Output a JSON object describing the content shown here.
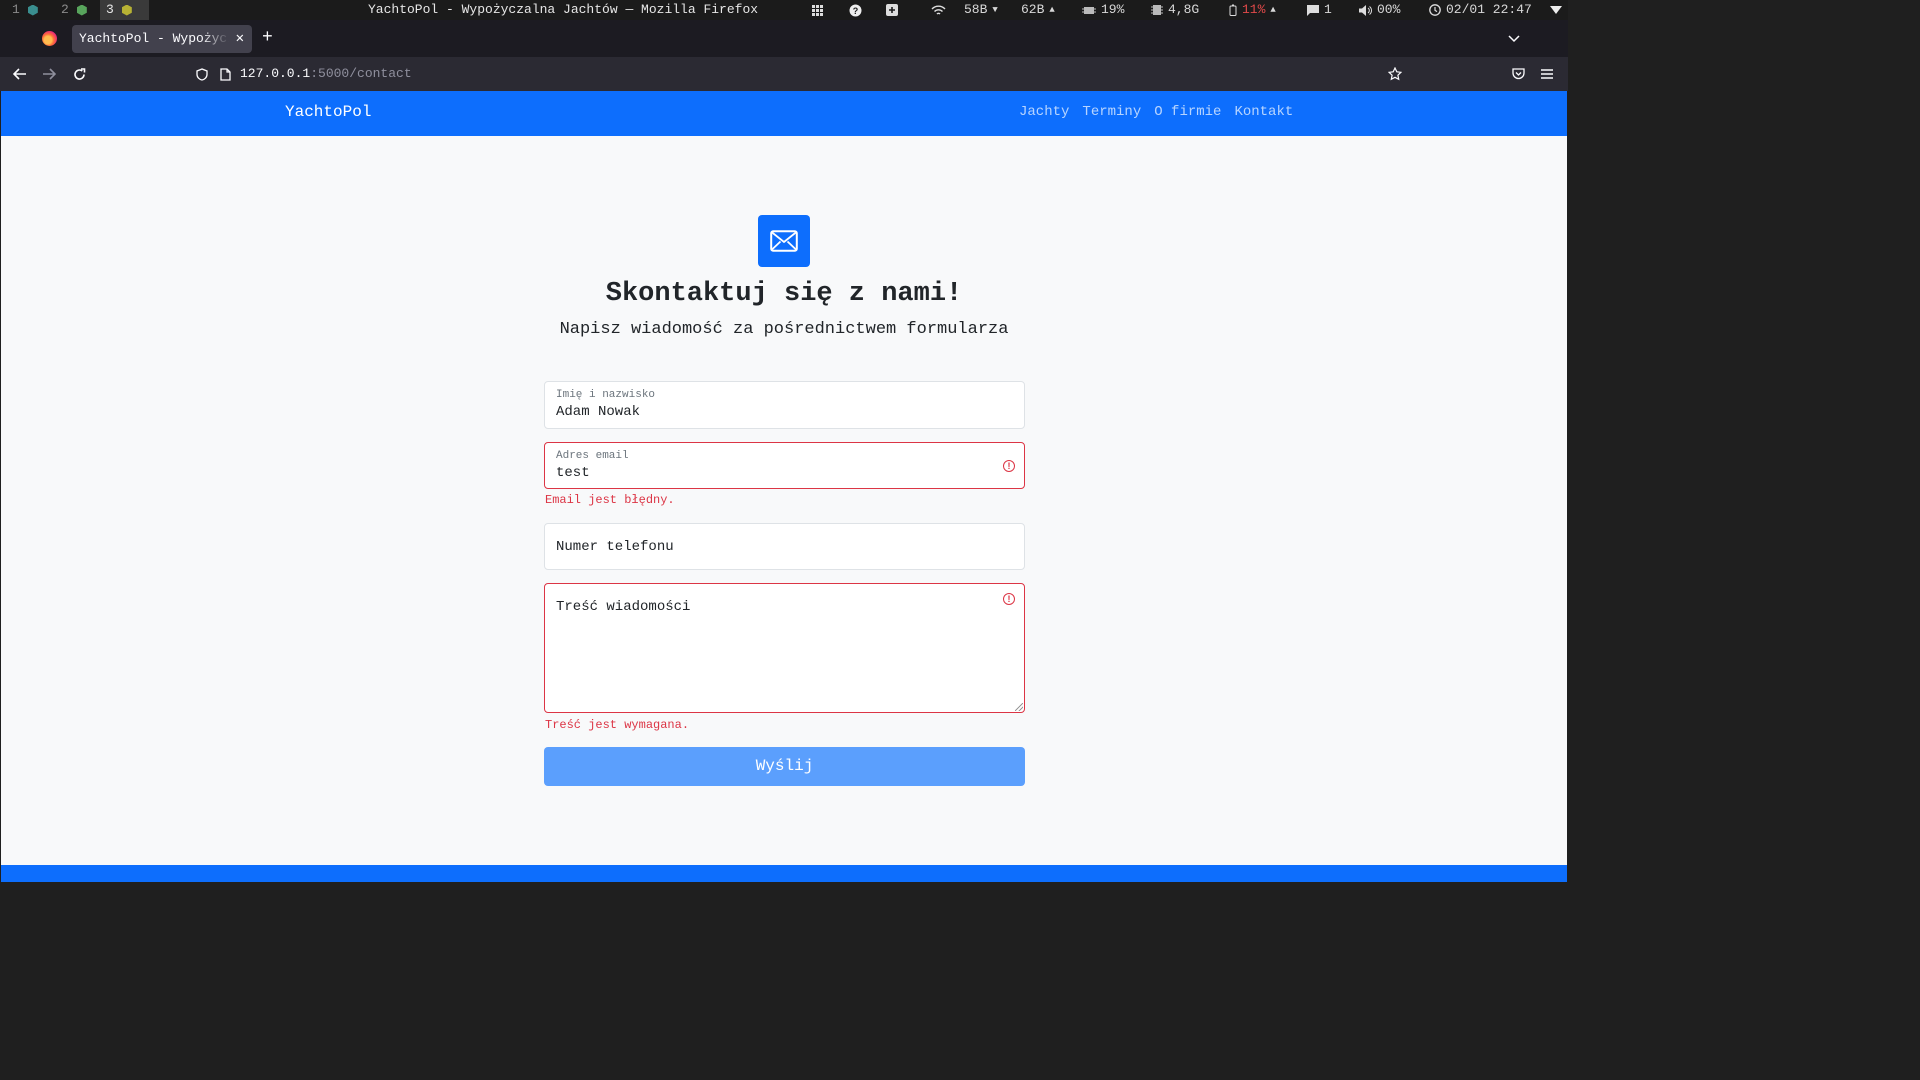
{
  "system_bar": {
    "workspaces": [
      {
        "num": "1",
        "color": "#3a8f8f"
      },
      {
        "num": "2",
        "color": "#58a55c"
      },
      {
        "num": "3",
        "color": "#b7b234"
      }
    ],
    "window_title": "YachtoPol - Wypożyczalna Jachtów — Mozilla Firefox",
    "net_down": "58B",
    "net_up": "62B",
    "cpu": "19%",
    "mem": "4,8G",
    "battery": "11%",
    "notifications": "1",
    "volume": "00%",
    "datetime": "02/01 22:47"
  },
  "browser": {
    "tab_title": "YachtoPol - Wypożyczalna Jachtów",
    "url_host": "127.0.0.1",
    "url_path": ":5000/contact"
  },
  "site": {
    "brand": "YachtoPol",
    "nav": [
      "Jachty",
      "Terminy",
      "O firmie",
      "Kontakt"
    ]
  },
  "contact": {
    "heading": "Skontaktuj się z nami!",
    "subheading": "Napisz wiadomość za pośrednictwem formularza",
    "name_label": "Imię i nazwisko",
    "name_value": "Adam Nowak",
    "email_label": "Adres email",
    "email_value": "test",
    "email_error": "Email jest błędny.",
    "phone_placeholder": "Numer telefonu",
    "message_placeholder": "Treść wiadomości",
    "message_error": "Treść jest wymagana.",
    "submit_label": "Wyślij"
  },
  "colors": {
    "primary": "#0d6efd",
    "error": "#dc3545"
  }
}
